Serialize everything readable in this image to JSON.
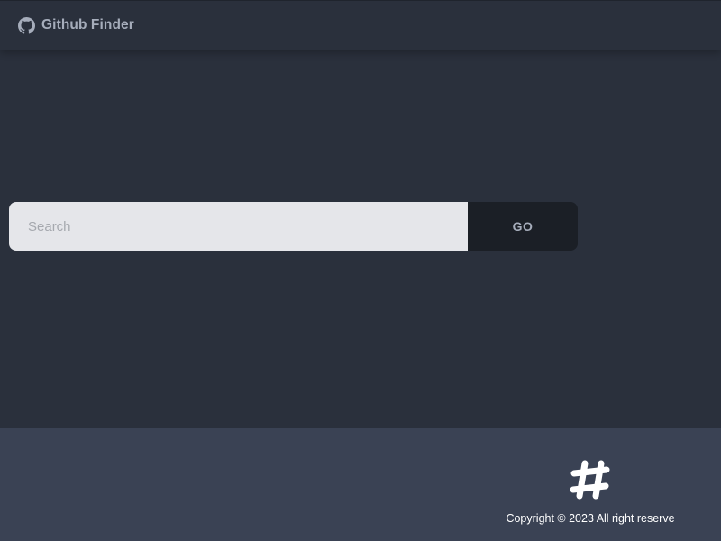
{
  "header": {
    "brand_icon": "github-icon",
    "brand_title": "Github Finder"
  },
  "search": {
    "placeholder": "Search",
    "value": "",
    "button_label": "GO"
  },
  "footer": {
    "logo_icon": "hashtag-icon",
    "copyright": "Copyright © 2023 All right reserve"
  },
  "colors": {
    "background": "#2a303c",
    "footer": "#3a4254",
    "input": "#e5e6ea",
    "button": "#1b1f26",
    "text_muted": "#a6adbb"
  }
}
